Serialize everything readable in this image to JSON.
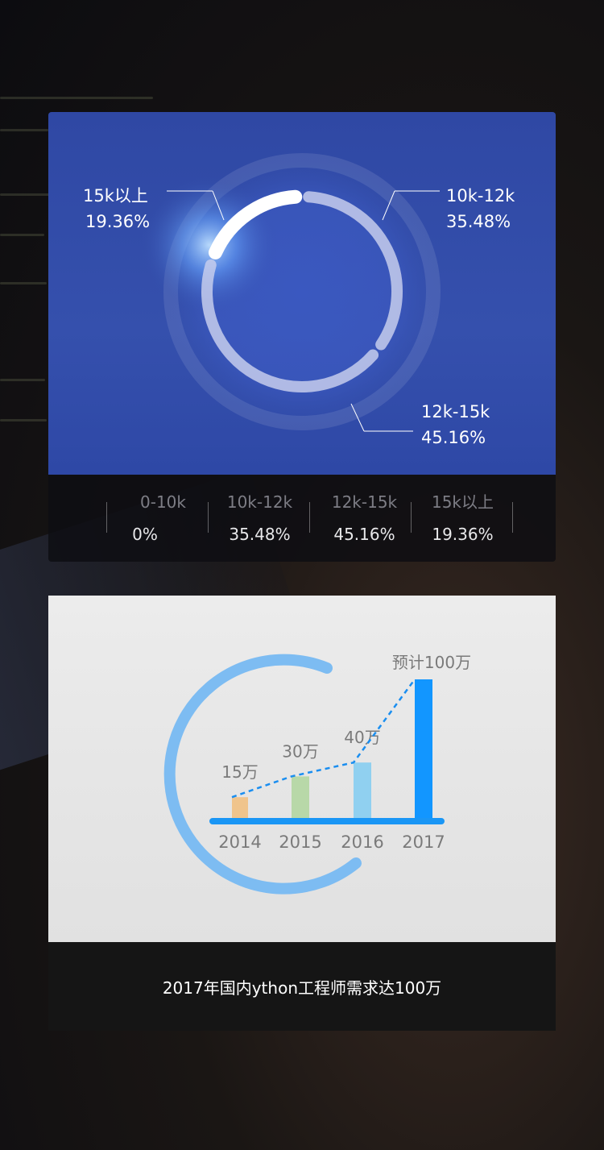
{
  "background": {
    "colors": {
      "panel_blue": "#3550ad",
      "arc_bright": "#ffffff",
      "arc_soft": "#c6ccec"
    }
  },
  "chart_data": [
    {
      "type": "pie",
      "style": "donut",
      "categories": [
        "0-10k",
        "10k-12k",
        "12k-15k",
        "15k以上"
      ],
      "values": [
        0,
        35.48,
        45.16,
        19.36
      ],
      "value_labels": [
        "0%",
        "35.48%",
        "45.16%",
        "19.36%"
      ],
      "callouts": [
        {
          "category": "15k以上",
          "value": "19.36%"
        },
        {
          "category": "10k-12k",
          "value": "35.48%"
        },
        {
          "category": "12k-15k",
          "value": "45.16%"
        }
      ],
      "legend_placement": "bottom",
      "title": ""
    },
    {
      "type": "bar",
      "categories": [
        "2014",
        "2015",
        "2016",
        "2017"
      ],
      "values": [
        15,
        30,
        40,
        100
      ],
      "unit": "万",
      "data_labels": [
        "15万",
        "30万",
        "40万",
        "预计100万"
      ],
      "colors": [
        "#f0c48c",
        "#b8d8a8",
        "#90d0f0",
        "#1296ff"
      ],
      "trend_line": {
        "style": "dashed",
        "color": "#1a8ef0"
      },
      "title": "",
      "xlabel": "",
      "ylabel": ""
    }
  ],
  "caption": "2017年国内ython工程师需求达100万"
}
